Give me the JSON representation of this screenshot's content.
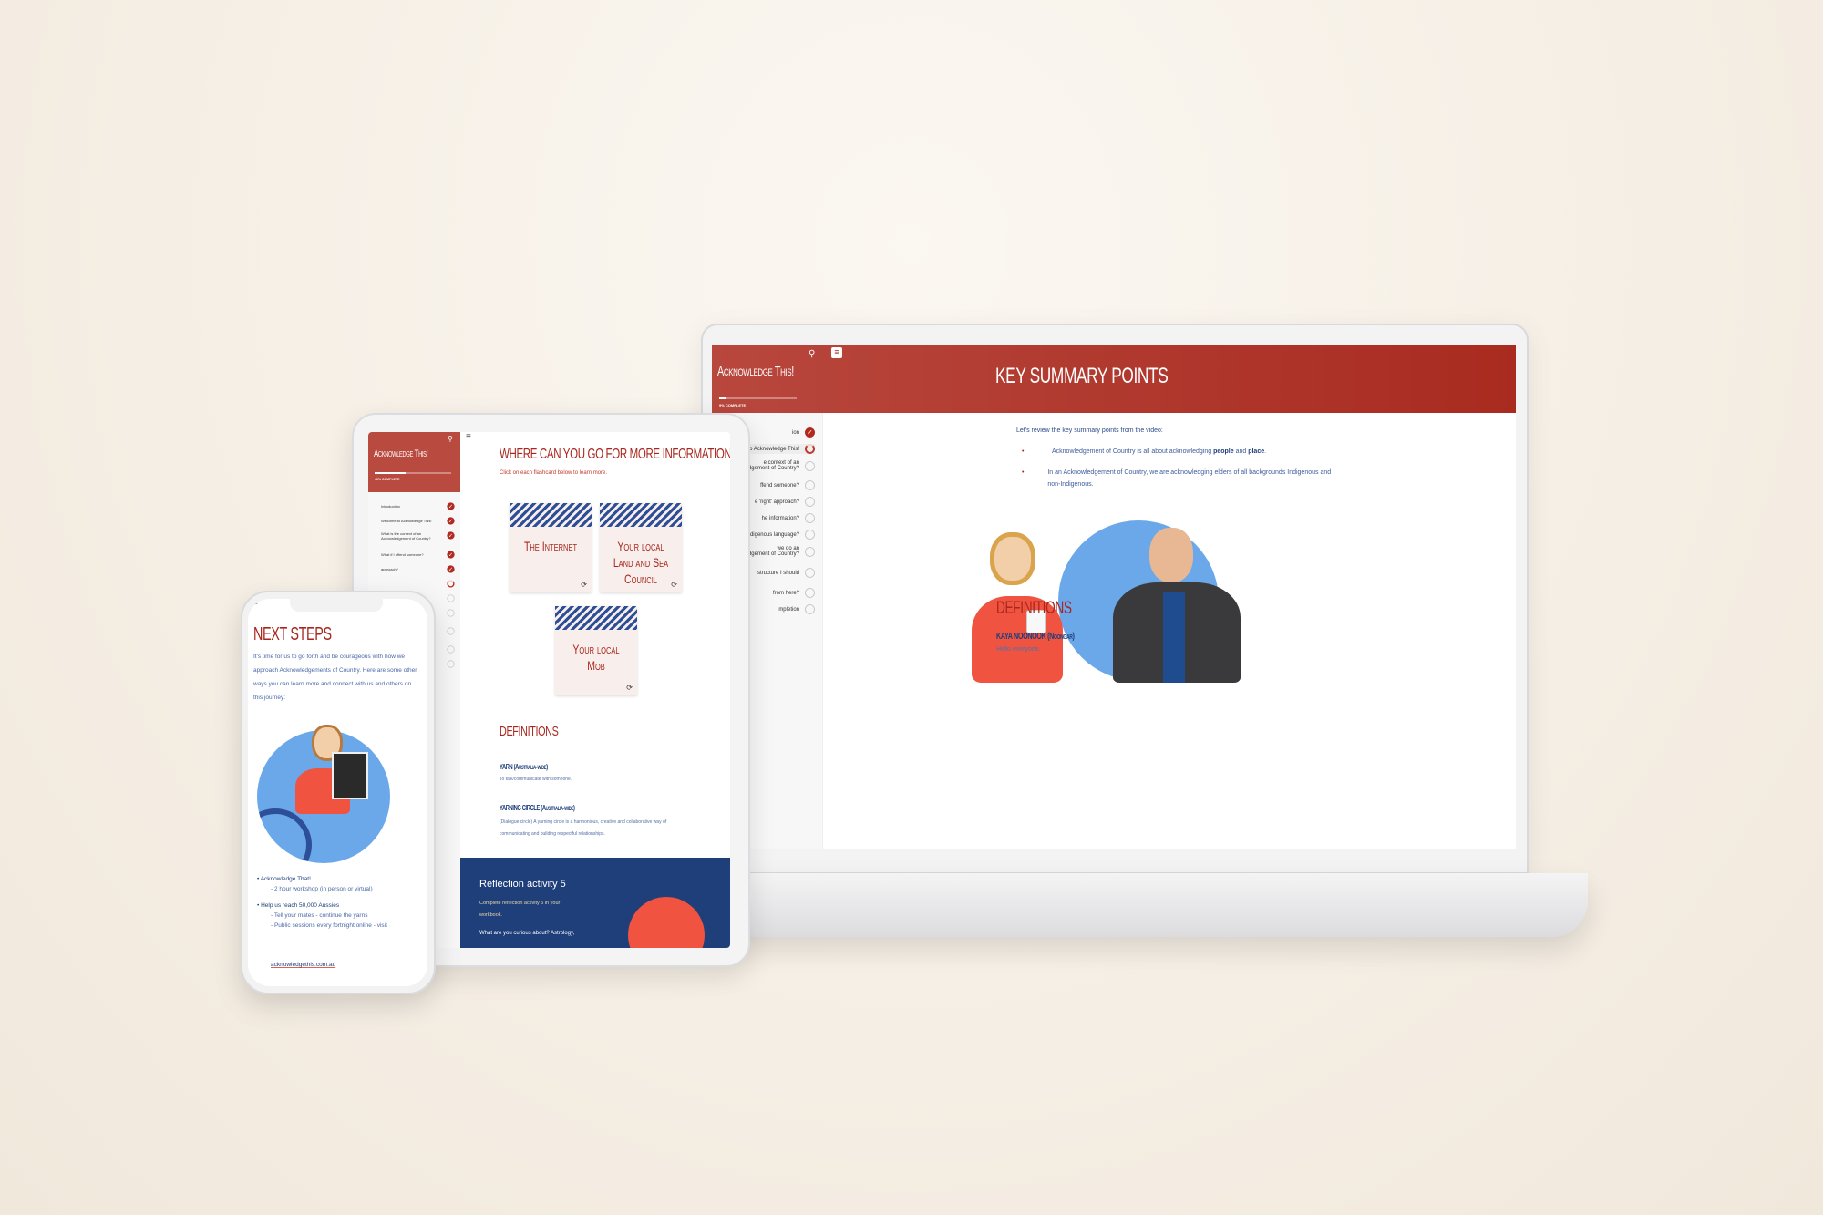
{
  "laptop": {
    "course_title": "Acknowledge This!",
    "progress_label": "9% COMPLETE",
    "progress": 9,
    "page_title": "KEY SUMMARY POINTS",
    "intro": "Let's review the key summary points from the video:",
    "bullets": [
      {
        "pre": "Acknowledgement of Country is all about acknowledging ",
        "b1": "people",
        "mid": " and ",
        "b2": "place",
        "post": "."
      },
      {
        "pre": "In an Acknowledgement of Country, we are acknowledging elders of all backgrounds Indigenous and non-Indigenous.",
        "b1": "",
        "mid": "",
        "b2": "",
        "post": ""
      }
    ],
    "sidebar": [
      {
        "label": "ion",
        "status": "complete"
      },
      {
        "label": "to Acknowledge This!",
        "status": "in-progress"
      },
      {
        "label": "e context of an\ndgement of Country?",
        "status": "incomplete"
      },
      {
        "label": "ffend someone?",
        "status": "incomplete"
      },
      {
        "label": "e 'right' approach?",
        "status": "incomplete"
      },
      {
        "label": "he information?",
        "status": "incomplete"
      },
      {
        "label": "Indigenous language?",
        "status": "incomplete"
      },
      {
        "label": "we do an\ndgement of Country?",
        "status": "incomplete"
      },
      {
        "label": "structure I should",
        "status": "incomplete"
      },
      {
        "label": "from here?",
        "status": "incomplete"
      },
      {
        "label": "mpletion",
        "status": "incomplete"
      }
    ],
    "definitions_heading": "DEFINITIONS",
    "term": "KAYA NOONOOK (Noongar)",
    "term_def": "Hello everyone."
  },
  "tablet": {
    "course_title": "Acknowledge This!",
    "progress_label": "40% COMPLETE",
    "progress": 40,
    "sidebar": [
      {
        "label": "Introduction",
        "status": "complete"
      },
      {
        "label": "Welcome to Acknowledge This!",
        "status": "complete"
      },
      {
        "label": "What is the context of an Acknowledgement of Country?",
        "status": "complete"
      },
      {
        "label": "What if I offend someone?",
        "status": "complete"
      },
      {
        "label": "approach?",
        "status": "complete"
      },
      {
        "label": "",
        "status": "in-progress"
      },
      {
        "label": "ge?",
        "status": "incomplete"
      },
      {
        "label": "ry?",
        "status": "incomplete"
      },
      {
        "label": "",
        "status": "incomplete"
      },
      {
        "label": "",
        "status": "incomplete"
      },
      {
        "label": "",
        "status": "incomplete"
      }
    ],
    "page_title": "WHERE CAN YOU GO FOR MORE INFORMATION?",
    "subtitle": "Click on each flashcard below to learn more.",
    "flashcards": [
      "The Internet",
      "Your local Land and Sea Council",
      "Your local Mob"
    ],
    "definitions_heading": "DEFINITIONS",
    "definitions": [
      {
        "term": "YARN (Australia-wide)",
        "def": "To talk/communicate with someone."
      },
      {
        "term": "YARNING CIRCLE (Australia-wide)",
        "def": "(Dialogue circle) A yarning circle is a harmonious, creative and collaborative way of communicating and building respectful relationships."
      }
    ],
    "reflection": {
      "title": "Reflection activity 5",
      "text": "Complete reflection activity 5 in your workbook.",
      "question": "What are you curious about? Astrology,"
    }
  },
  "phone": {
    "title": "NEXT STEPS",
    "body": "It's time for us to go forth and be courageous with how we approach Acknowledgements of Country. Here are some other ways you can learn more and connect with us and others on this journey:",
    "list": [
      {
        "head": "Acknowledge That!",
        "subs": [
          "- 2 hour workshop (in person or virtual)"
        ]
      },
      {
        "head": "Help us reach 50,000 Aussies",
        "subs": [
          "- Tell your mates - continue the yarns",
          "- Public sessions every fortnight online - visit"
        ]
      }
    ],
    "link": "acknowledgethis.com.au"
  },
  "colors": {
    "brand_red": "#a8261d",
    "navy": "#1f3f7a",
    "accent_blue": "#6aa8ea",
    "coral": "#f0533f"
  }
}
